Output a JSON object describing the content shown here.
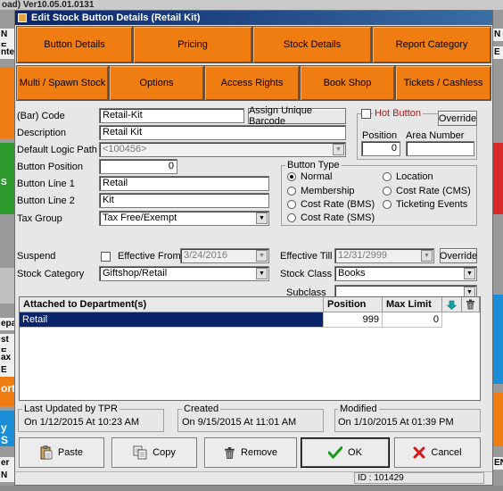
{
  "background": {
    "title": "oad) Ver10.05.01.0131",
    "left_labels": [
      "N E",
      "nte",
      "S"
    ],
    "left_labels2": [
      "epa",
      "st E",
      "ax E",
      "ort",
      "y S",
      "er N"
    ],
    "right_labels": [
      "N",
      "E",
      "EN"
    ]
  },
  "dialog": {
    "title": "Edit Stock Button Details (Retail Kit)",
    "tabs_row1": [
      "Button Details",
      "Pricing",
      "Stock Details",
      "Report Category"
    ],
    "tabs_row2": [
      "Multi / Spawn Stock",
      "Options",
      "Access Rights",
      "Book Shop",
      "Tickets / Cashless"
    ],
    "form": {
      "barcode_label": "(Bar) Code",
      "barcode_value": "Retail-Kit",
      "assign_barcode_label": "Assign Unique Barcode",
      "description_label": "Description",
      "description_value": "Retail Kit",
      "logic_path_label": "Default Logic Path",
      "logic_path_value": "<100456>",
      "button_position_label": "Button Position",
      "button_position_value": "0",
      "line1_label": "Button Line 1",
      "line1_value": "Retail",
      "line2_label": "Button Line 2",
      "line2_value": "Kit",
      "tax_group_label": "Tax Group",
      "tax_group_value": "Tax Free/Exempt",
      "hot_button_label": "Hot Button",
      "override_label": "Override",
      "position_label": "Position",
      "position_value": "0",
      "area_number_label": "Area Number",
      "area_number_value": "",
      "button_type_label": "Button Type",
      "button_types": [
        "Normal",
        "Membership",
        "Cost Rate (BMS)",
        "Cost Rate (SMS)",
        "Location",
        "Cost Rate (CMS)",
        "Ticketing Events"
      ],
      "suspend_label": "Suspend",
      "effective_from_label": "Effective From",
      "effective_from_value": "3/24/2016",
      "effective_till_label": "Effective Till",
      "effective_till_value": "12/31/2999",
      "override2_label": "Override",
      "stock_category_label": "Stock Category",
      "stock_category_value": "Giftshop/Retail",
      "stock_class_label": "Stock Class",
      "stock_class_value": "Books",
      "subclass_label": "Subclass",
      "subclass_value": ""
    },
    "grid": {
      "headers": [
        "Attached to Department(s)",
        "Position",
        "Max Limit"
      ],
      "rows": [
        {
          "department": "Retail",
          "position": "999",
          "max_limit": "0"
        }
      ]
    },
    "audit": {
      "last_updated_label": "Last Updated by TPR",
      "last_updated_value": "On   1/12/2015  At    10:23 AM",
      "created_label": "Created",
      "created_value": "On   9/15/2015  At   11:01 AM",
      "modified_label": "Modified",
      "modified_value": "On   1/10/2015  At    01:39 PM"
    },
    "buttons": {
      "paste": "Paste",
      "copy": "Copy",
      "remove": "Remove",
      "ok": "OK",
      "cancel": "Cancel"
    },
    "status_id": "ID : 101429"
  },
  "colors": {
    "accent": "#f07d12",
    "selection": "#0a246a"
  }
}
